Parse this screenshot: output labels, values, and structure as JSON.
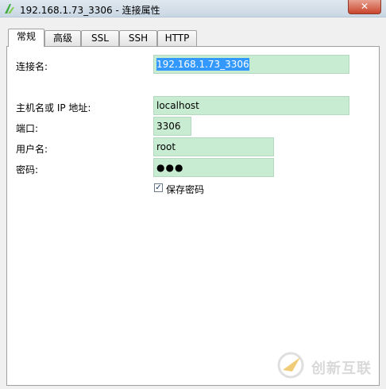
{
  "window": {
    "title": "192.168.1.73_3306 - 连接属性",
    "close_glyph": "✕"
  },
  "tabs": [
    {
      "label": "常规",
      "active": true
    },
    {
      "label": "高级"
    },
    {
      "label": "SSL"
    },
    {
      "label": "SSH"
    },
    {
      "label": "HTTP"
    }
  ],
  "form": {
    "connection_name": {
      "label": "连接名:",
      "value": "192.168.1.73_3306"
    },
    "host": {
      "label": "主机名或 IP 地址:",
      "value": "localhost"
    },
    "port": {
      "label": "端口:",
      "value": "3306"
    },
    "username": {
      "label": "用户名:",
      "value": "root"
    },
    "password": {
      "label": "密码:",
      "value": "●●●"
    },
    "save_password": {
      "label": "保存密码",
      "checked": true,
      "check_glyph": "✓"
    }
  },
  "watermark": {
    "text": "创新互联"
  },
  "colors": {
    "field_bg": "#c8ecd2",
    "selection": "#3399ff"
  },
  "icons": {
    "app": "navicat-icon",
    "watermark": "logo-icon"
  }
}
